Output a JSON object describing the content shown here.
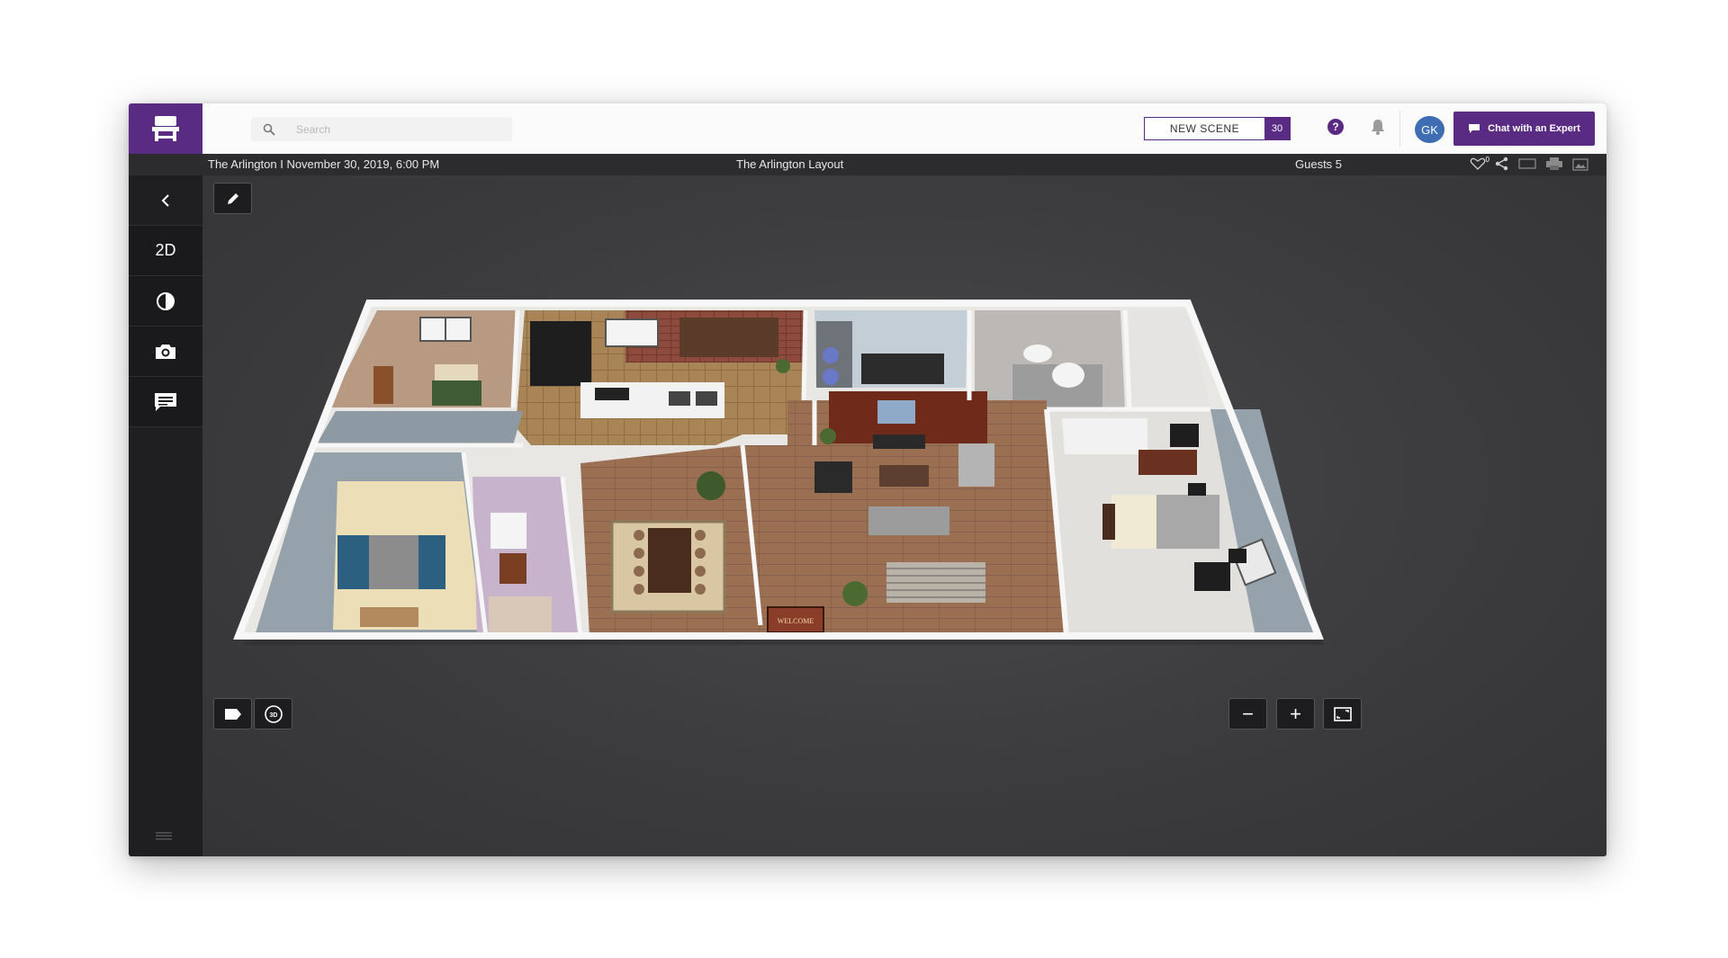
{
  "search": {
    "placeholder": "Search"
  },
  "scene": {
    "new_scene_label": "NEW SCENE",
    "count": "30"
  },
  "help_label": "?",
  "user": {
    "initials": "GK"
  },
  "chat": {
    "label": "Chat with an Expert"
  },
  "info": {
    "event": "The Arlington I November 30, 2019, 6:00 PM",
    "layout_title": "The Arlington Layout",
    "guests": "Guests 5",
    "favorites_count": "0"
  },
  "sidebar": {
    "back_icon": "chevron-left-icon",
    "view_2d_label": "2D",
    "contrast_icon": "contrast-icon",
    "camera_icon": "camera-icon",
    "comments_icon": "comment-icon",
    "menu_icon": "hamburger-icon"
  },
  "floorplan": {
    "welcome_mat": "WELCOME"
  },
  "toolbar": {
    "view_3d_label": "3D",
    "zoom_out": "−",
    "zoom_in": "+"
  },
  "colors": {
    "brand": "#5a2b82",
    "avatar": "#3e6db3",
    "sidebar": "#1f1f21",
    "canvas": "#3a3a3c"
  }
}
